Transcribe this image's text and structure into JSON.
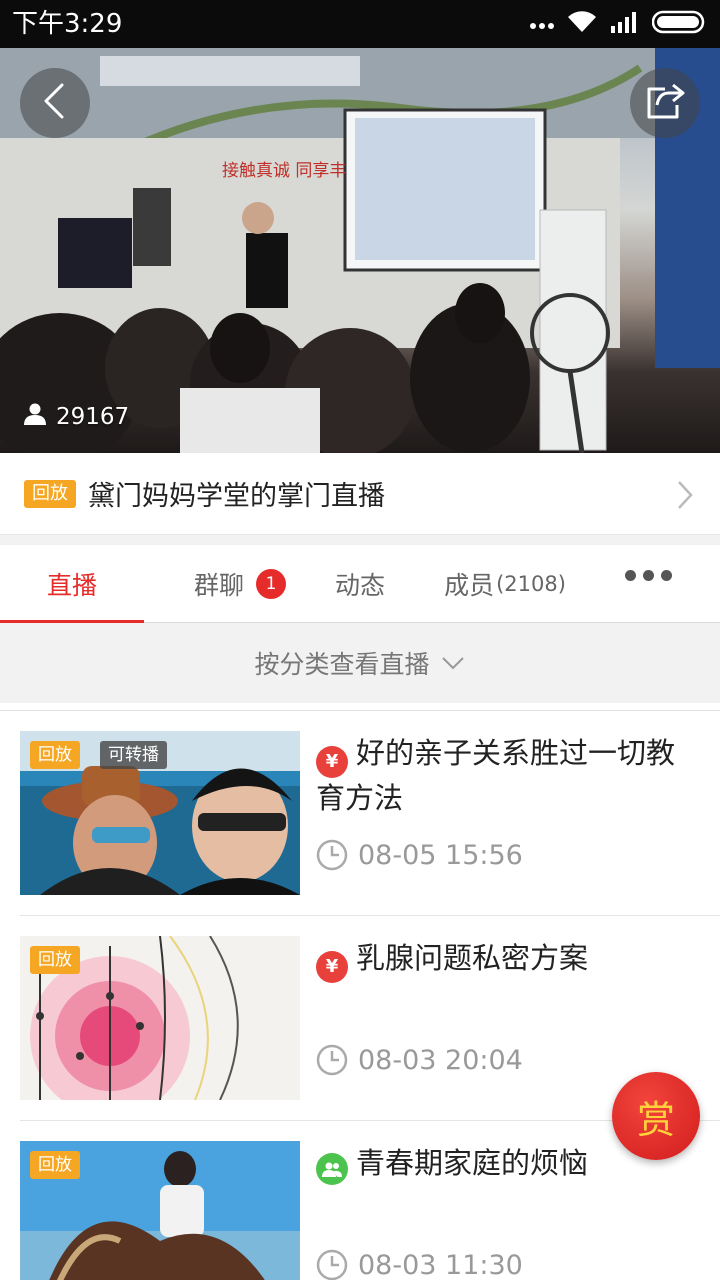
{
  "status_bar": {
    "time": "下午3:29",
    "icons": [
      "more-dots-icon",
      "wifi-icon",
      "signal-icon",
      "battery-icon"
    ]
  },
  "hero": {
    "viewer_count": "29167",
    "banner_text": "接触真诚 同享丰",
    "icons": [
      "back-arrow-icon",
      "share-icon",
      "person-icon"
    ]
  },
  "live": {
    "badge": "回放",
    "title": "黛门妈妈学堂的掌门直播"
  },
  "tabs": [
    {
      "label": "直播",
      "active": true
    },
    {
      "label": "群聊",
      "badge": "1"
    },
    {
      "label": "动态"
    },
    {
      "label": "成员",
      "count": "(2108)"
    }
  ],
  "category_filter": {
    "label": "按分类查看直播"
  },
  "list": [
    {
      "badge": "回放",
      "badge2": "可转播",
      "type_icon": "¥",
      "title": "好的亲子关系胜过一切教育方法",
      "time": "08-05 15:56"
    },
    {
      "badge": "回放",
      "type_icon": "¥",
      "title": "乳腺问题私密方案",
      "time": "08-03 20:04"
    },
    {
      "badge": "回放",
      "type_icon": "group",
      "title": "青春期家庭的烦恼",
      "time": "08-03 11:30"
    }
  ],
  "reward_button": {
    "label": "赏"
  },
  "colors": {
    "accent": "#e62b2b",
    "badge": "#f5a623",
    "paid_icon": "#e8403a",
    "group_icon": "#4cc34d"
  }
}
